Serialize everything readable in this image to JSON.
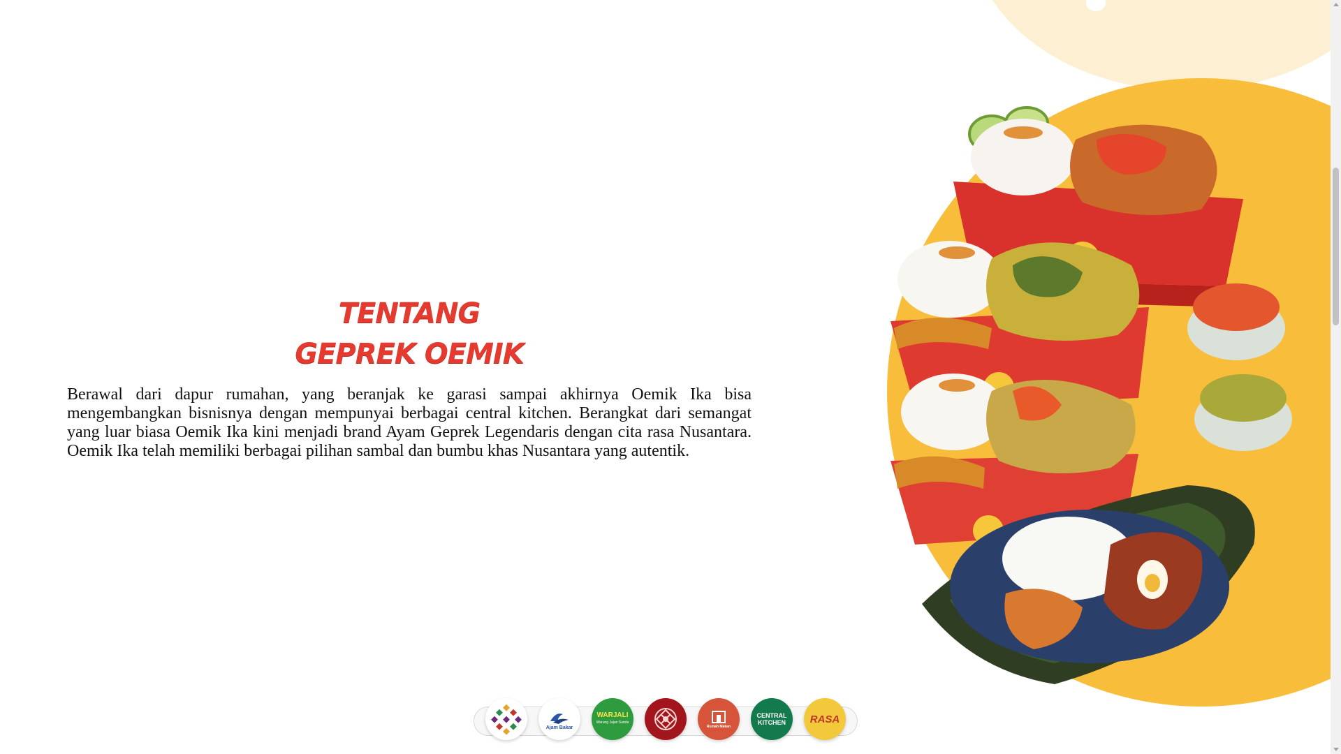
{
  "about": {
    "title_line1": "Tentang",
    "title_line2": "Geprek Oemik",
    "description": "Berawal dari dapur rumahan, yang beranjak ke garasi sampai akhirnya Oemik Ika bisa mengembangkan bisnisnya dengan mempunyai berbagai central kitchen. Berangkat dari semangat yang luar biasa Oemik Ika kini menjadi brand Ayam Geprek Legendaris dengan cita rasa Nusantara. Oemik Ika telah memiliki berbagai pilihan sambal dan bumbu khas Nusantara yang autentik."
  },
  "brands": [
    {
      "name": "mosaic-brand-logo"
    },
    {
      "name": "ajam-bakar-logo",
      "text": "Ajam Bakar"
    },
    {
      "name": "warjali-logo",
      "text": "WARJALI",
      "subtext": "Warung Jajan Sunda"
    },
    {
      "name": "ornament-brand-logo"
    },
    {
      "name": "house-brand-logo",
      "text": "Rumah Makan"
    },
    {
      "name": "central-kitchen-logo",
      "text": "CENTRAL KITCHEN"
    },
    {
      "name": "rasa-logo",
      "text": "RASA"
    }
  ],
  "colors": {
    "accent_red": "#e53a2f",
    "yellow": "#f9bd3c",
    "cream": "#fdefd2"
  }
}
